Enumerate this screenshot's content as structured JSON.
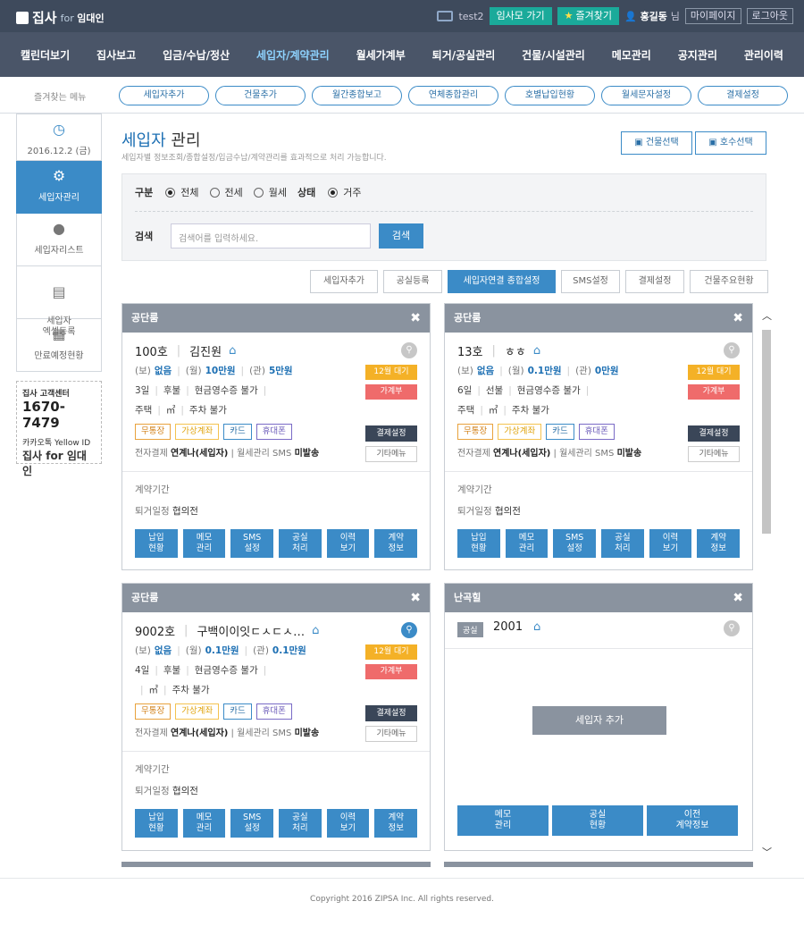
{
  "app": {
    "logo_main": "집사",
    "logo_for": "for",
    "logo_target": "임대인"
  },
  "topbar": {
    "user_id": "test2",
    "goto_label": "임사모 가기",
    "favorite_label": "즐겨찾기",
    "user_name": "홍길동",
    "honorific": "님",
    "mypage_label": "마이페이지",
    "logout_label": "로그아웃"
  },
  "nav": [
    "캘린더보기",
    "집사보고",
    "입금/수납/정산",
    "세입자/계약관리",
    "월세가계부",
    "퇴거/공실관리",
    "건물/시설관리",
    "메모관리",
    "공지관리",
    "관리이력"
  ],
  "favbar": {
    "label": "즐겨찾는 메뉴",
    "items": [
      "세입자추가",
      "건물추가",
      "월간종합보고",
      "연체종합관리",
      "호별납입현황",
      "월세문자설정",
      "결제설정"
    ]
  },
  "sidebar": {
    "date": "2016.12.2 (금)",
    "items": [
      "세입자관리",
      "세입자리스트",
      "세입자\n엑셀등록",
      "만료예정현황"
    ],
    "promo": {
      "center": "집사 고객센터",
      "phone": "1670-7479",
      "kakao": "카카오톡 Yellow ID",
      "brand": "집사 for 임대인"
    }
  },
  "page": {
    "title_blue": "세입자",
    "title_rest": "관리",
    "subtitle": "세입자별 정보조회/종합설정/입금수납/계약관리를 효과적으로 처리 가능합니다.",
    "btn_building": "건물선택",
    "btn_unit": "호수선택"
  },
  "search": {
    "type_label": "구분",
    "opt_all": "전체",
    "opt_jeonse": "전세",
    "opt_wolse": "월세",
    "status_label": "상태",
    "status_opt": "거주",
    "search_label": "검색",
    "placeholder": "검색어를 입력하세요.",
    "button": "검색"
  },
  "actions": [
    "세입자추가",
    "공실등록",
    "세입자연결 종합설정",
    "SMS설정",
    "결제설정",
    "건물주요현황"
  ],
  "cards": [
    {
      "building": "공단룸",
      "unit": "100호",
      "name": "김진원",
      "deposit": "없음",
      "rent": "10만원",
      "mgmt": "5만원",
      "day": "3일",
      "timing": "후불",
      "receipt": "현금영수증 불가",
      "type": "주택",
      "area": "㎡",
      "parking": "주차 불가",
      "e_pay": "연계나(세입자)",
      "sms": "미발송",
      "period_label": "계약기간",
      "moveout_label": "퇴거일정",
      "moveout": "협의전"
    },
    {
      "building": "공단룸",
      "unit": "13호",
      "name": "ㅎㅎ",
      "deposit": "없음",
      "rent": "0.1만원",
      "mgmt": "0만원",
      "day": "6일",
      "timing": "선불",
      "receipt": "현금영수증 불가",
      "type": "주택",
      "area": "㎡",
      "parking": "주차 불가",
      "e_pay": "연계나(세입자)",
      "sms": "미발송",
      "period_label": "계약기간",
      "moveout_label": "퇴거일정",
      "moveout": "협의전"
    },
    {
      "building": "공단룸",
      "unit": "9002호",
      "name": "구백이이잇ㄷㅅㄷㅅ…",
      "deposit": "없음",
      "rent": "0.1만원",
      "mgmt": "0.1만원",
      "day": "4일",
      "timing": "후불",
      "receipt": "현금영수증 불가",
      "type": "",
      "area": "㎡",
      "parking": "주차 불가",
      "e_pay": "연계나(세입자)",
      "sms": "미발송",
      "period_label": "계약기간",
      "moveout_label": "퇴거일정",
      "moveout": "협의전"
    }
  ],
  "vacant": {
    "building": "난곡힐",
    "tag": "공실",
    "unit": "2001",
    "add": "세입자 추가",
    "buttons": [
      "메모\n관리",
      "공실\n현황",
      "이전\n계약정보"
    ]
  },
  "labels": {
    "bo": "(보)",
    "wol": "(월)",
    "gwan": "(관)",
    "wait": "12월 대기",
    "ledger": "가계부",
    "pay": [
      "무통장",
      "가상계좌",
      "카드",
      "휴대폰"
    ],
    "setting": "결제설정",
    "etc": "기타메뉴",
    "e_label": "전자결제",
    "sms_label": "월세관리 SMS",
    "grid": [
      "납입\n현황",
      "메모\n관리",
      "SMS\n설정",
      "공실\n처리",
      "이력\n보기",
      "계약\n정보"
    ]
  },
  "footer": "Copyright 2016 ZIPSA Inc. All rights reserved."
}
